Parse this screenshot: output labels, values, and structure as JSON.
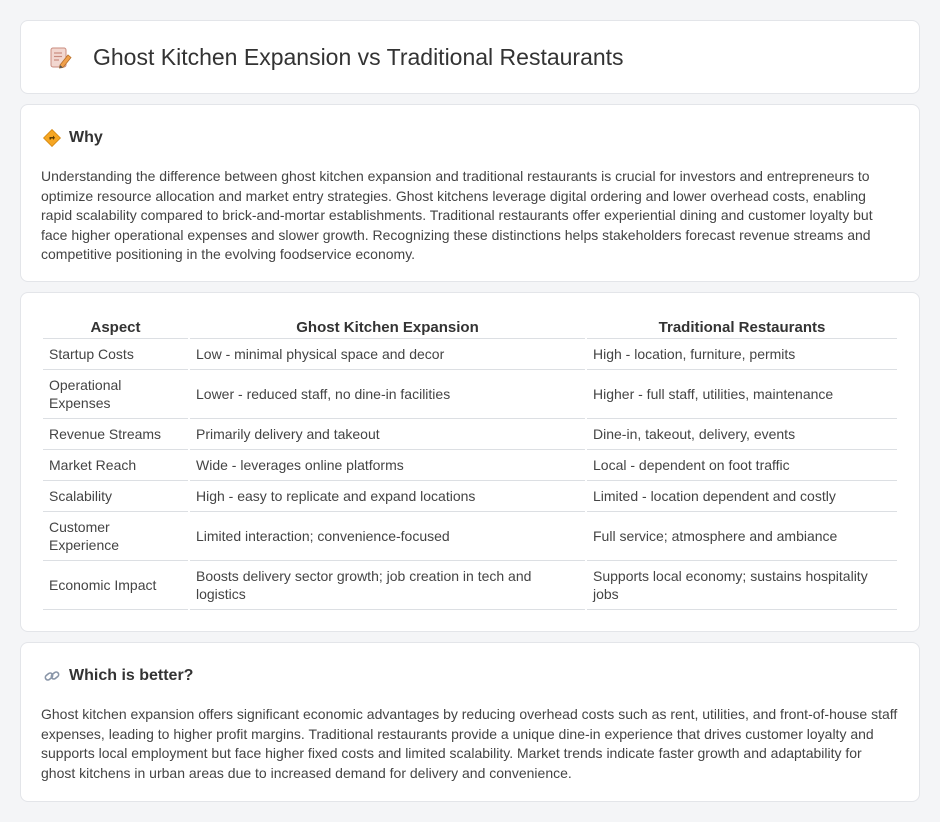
{
  "header": {
    "title": "Ghost Kitchen Expansion vs Traditional Restaurants",
    "icon": "notepad-pencil-icon"
  },
  "why": {
    "title": "Why",
    "icon": "diamond-direction-icon",
    "text": "Understanding the difference between ghost kitchen expansion and traditional restaurants is crucial for investors and entrepreneurs to optimize resource allocation and market entry strategies. Ghost kitchens leverage digital ordering and lower overhead costs, enabling rapid scalability compared to brick-and-mortar establishments. Traditional restaurants offer experiential dining and customer loyalty but face higher operational expenses and slower growth. Recognizing these distinctions helps stakeholders forecast revenue streams and competitive positioning in the evolving foodservice economy."
  },
  "comparison": {
    "headers": [
      "Aspect",
      "Ghost Kitchen Expansion",
      "Traditional Restaurants"
    ],
    "rows": [
      [
        "Startup Costs",
        "Low - minimal physical space and decor",
        "High - location, furniture, permits"
      ],
      [
        "Operational Expenses",
        "Lower - reduced staff, no dine-in facilities",
        "Higher - full staff, utilities, maintenance"
      ],
      [
        "Revenue Streams",
        "Primarily delivery and takeout",
        "Dine-in, takeout, delivery, events"
      ],
      [
        "Market Reach",
        "Wide - leverages online platforms",
        "Local - dependent on foot traffic"
      ],
      [
        "Scalability",
        "High - easy to replicate and expand locations",
        "Limited - location dependent and costly"
      ],
      [
        "Customer Experience",
        "Limited interaction; convenience-focused",
        "Full service; atmosphere and ambiance"
      ],
      [
        "Economic Impact",
        "Boosts delivery sector growth; job creation in tech and logistics",
        "Supports local economy; sustains hospitality jobs"
      ]
    ]
  },
  "better": {
    "title": "Which is better?",
    "icon": "link-icon",
    "text": "Ghost kitchen expansion offers significant economic advantages by reducing overhead costs such as rent, utilities, and front-of-house staff expenses, leading to higher profit margins. Traditional restaurants provide a unique dine-in experience that drives customer loyalty and supports local employment but face higher fixed costs and limited scalability. Market trends indicate faster growth and adaptability for ghost kitchens in urban areas due to increased demand for delivery and convenience."
  }
}
